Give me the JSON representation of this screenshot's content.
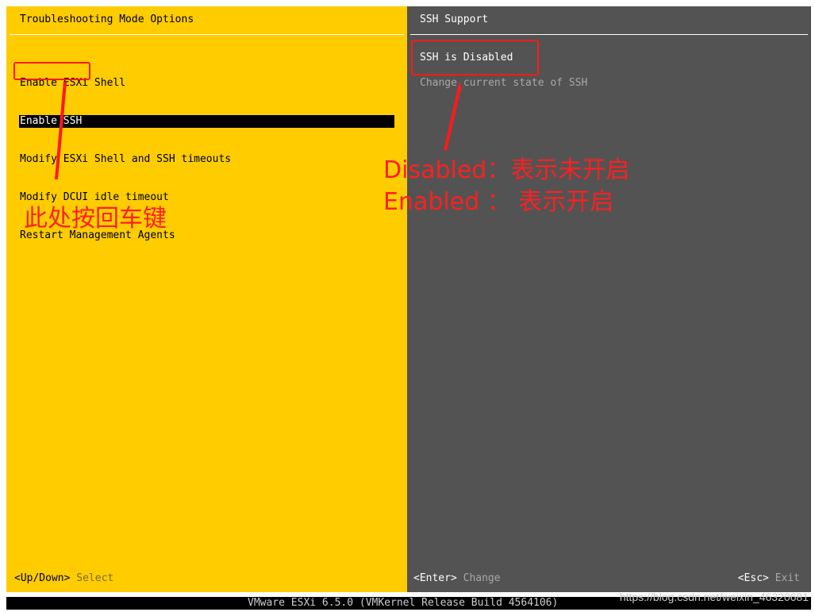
{
  "left_panel": {
    "title": "Troubleshooting Mode Options",
    "menu": [
      {
        "label": "Enable ESXi Shell",
        "selected": false
      },
      {
        "label": "Enable SSH",
        "selected": true
      },
      {
        "label": "Modify ESXi Shell and SSH timeouts",
        "selected": false
      },
      {
        "label": "Modify DCUI idle timeout",
        "selected": false
      },
      {
        "label": "Restart Management Agents",
        "selected": false
      }
    ],
    "footer": {
      "key": "<Up/Down>",
      "action": "Select"
    },
    "background_color": "#ffcc00"
  },
  "right_panel": {
    "title": "SSH Support",
    "status": "SSH is Disabled",
    "description": "Change current state of SSH",
    "footer_enter": {
      "key": "<Enter>",
      "action": "Change"
    },
    "footer_esc": {
      "key": "<Esc>",
      "action": "Exit"
    },
    "background_color": "#535353"
  },
  "status_bar": {
    "build_info": "VMware ESXi 6.5.0 (VMKernel Release Build 4564106)"
  },
  "watermark": "https://blog.csdn.net/weixin_46320681",
  "annotations": {
    "left_note": "此处按回车键",
    "right_note_line1": "Disabled：表示未开启",
    "right_note_line2": "Enabled ： 表示开启",
    "color": "#ff1a1a"
  }
}
